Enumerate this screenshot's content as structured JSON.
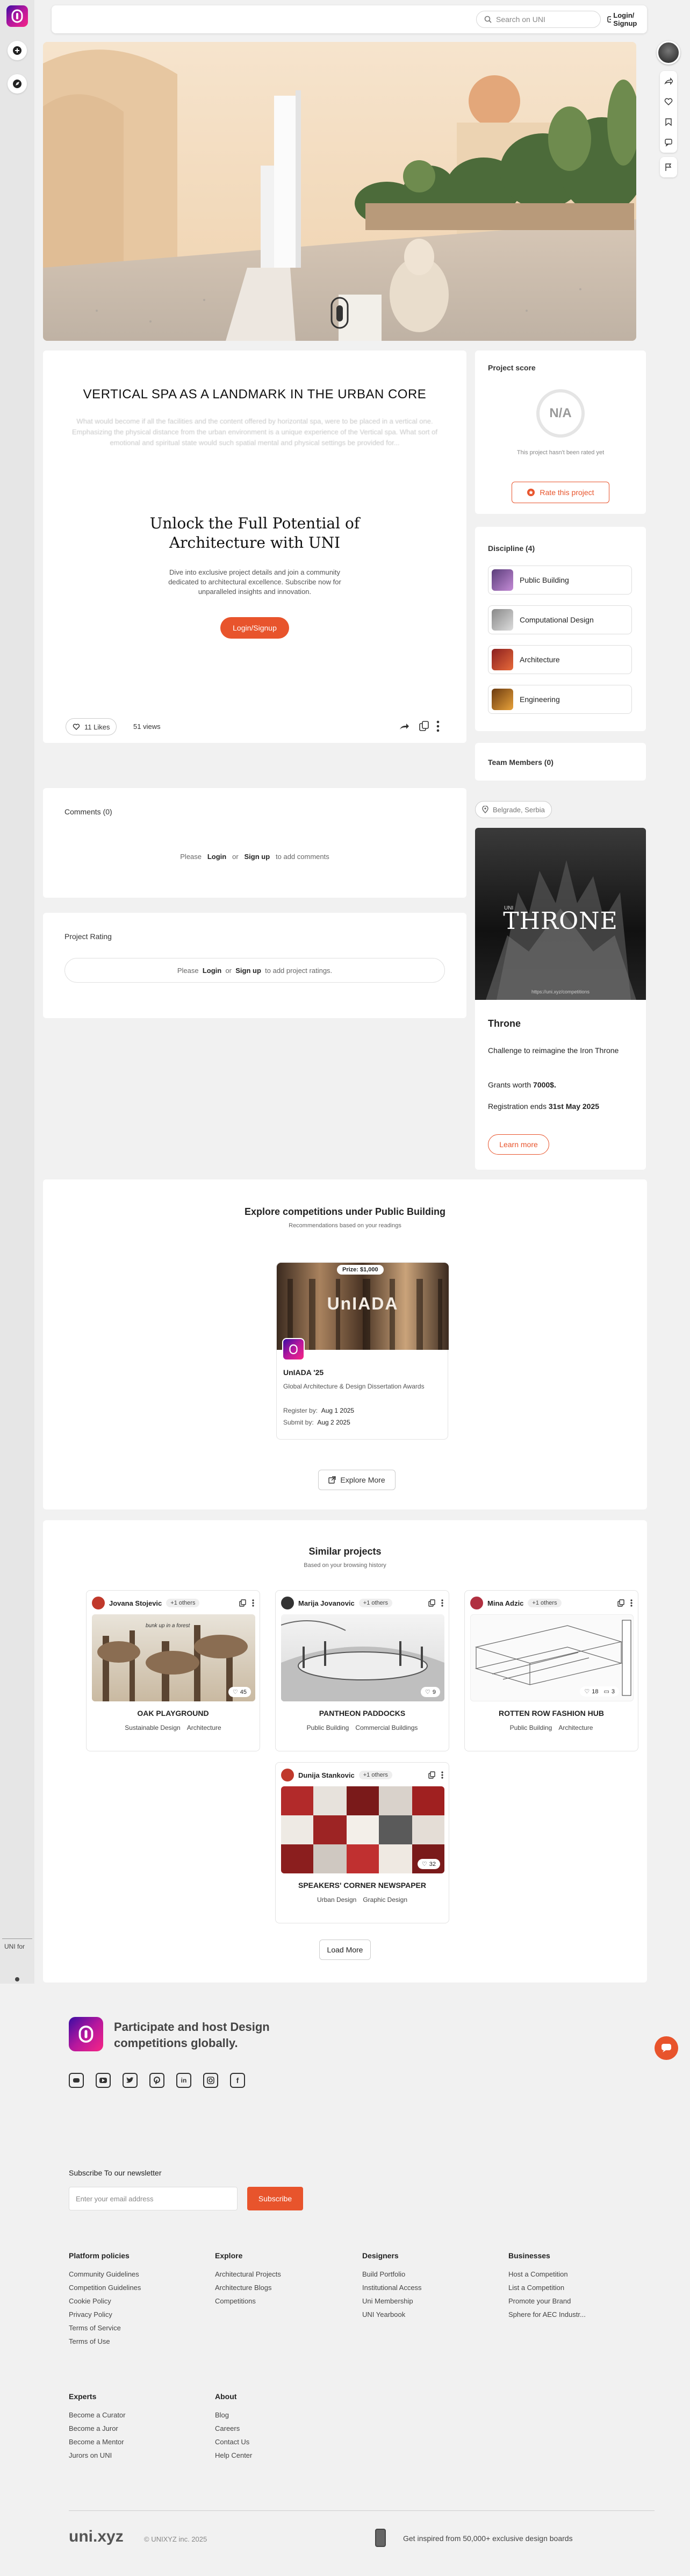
{
  "topbar": {
    "search_placeholder": "Search on UNI",
    "login_label": "Login/ Signup"
  },
  "sidebar": {
    "uni_for_label": "UNI for"
  },
  "project": {
    "title": "VERTICAL SPA AS A LANDMARK IN THE URBAN CORE",
    "description_preview": "What would become if all the facilities and the content offered by horizontal spa, were to be placed in a vertical one. Emphasizing the physical distance from the urban environment is a unique experience of the Vertical spa. What sort of emotional and spiritual state would such spatial mental and physical settings be provided for...",
    "unlock_title": "Unlock the Full Potential of Architecture with UNI",
    "unlock_text": "Dive into exclusive project details and join a community dedicated to architectural excellence. Subscribe now for unparalleled insights and innovation.",
    "unlock_button": "Login/Signup",
    "likes": "11 Likes",
    "views": "51 views"
  },
  "score": {
    "label": "Project score",
    "value": "N/A",
    "note": "This project hasn't been rated yet",
    "rate_button": "Rate this project"
  },
  "discipline": {
    "label": "Discipline (4)",
    "items": [
      {
        "label": "Public Building"
      },
      {
        "label": "Computational Design"
      },
      {
        "label": "Architecture"
      },
      {
        "label": "Engineering"
      }
    ]
  },
  "team": {
    "label": "Team Members (0)"
  },
  "location": {
    "label": "Belgrade, Serbia"
  },
  "comments": {
    "label": "Comments (0)",
    "please": "Please",
    "login": "Login",
    "or": "or",
    "signup": "Sign up",
    "suffix": "to add comments"
  },
  "rating": {
    "label": "Project Rating",
    "please": "Please",
    "login": "Login",
    "or": "or",
    "signup": "Sign up",
    "suffix": "to add project ratings."
  },
  "promo": {
    "image_title": "THRONE",
    "image_prefix": "UNI",
    "image_url": "https://uni.xyz/competitions",
    "title": "Throne",
    "desc": "Challenge to reimagine the Iron Throne",
    "grants_prefix": "Grants worth ",
    "grants_value": "7000$.",
    "reg_prefix": "Registration ends ",
    "reg_value": "31st May 2025",
    "button": "Learn more"
  },
  "explore": {
    "title": "Explore competitions under Public Building",
    "subtitle": "Recommendations based on your readings",
    "comp": {
      "prize": "Prize: $1,000",
      "image_text": "UnIADA",
      "name": "UnIADA '25",
      "desc": "Global Architecture & Design Dissertation Awards",
      "register_label": "Register by:",
      "register_date": "Aug 1 2025",
      "submit_label": "Submit by:",
      "submit_date": "Aug 2 2025"
    },
    "button": "Explore More"
  },
  "similar": {
    "title": "Similar projects",
    "subtitle": "Based on your browsing history",
    "projects": [
      {
        "author": "Jovana Stojevic",
        "others": "+1 others",
        "name": "OAK PLAYGROUND",
        "tags": [
          "Sustainable Design",
          "Architecture"
        ],
        "likes": "45",
        "img_caption": "bunk up in a forest"
      },
      {
        "author": "Marija Jovanovic",
        "others": "+1 others",
        "name": "PANTHEON PADDOCKS",
        "tags": [
          "Public Building",
          "Commercial Buildings"
        ],
        "likes": "9"
      },
      {
        "author": "Mina Adzic",
        "others": "+1 others",
        "name": "ROTTEN ROW FASHION HUB",
        "tags": [
          "Public Building",
          "Architecture"
        ],
        "likes": "18",
        "comments": "3"
      },
      {
        "author": "Dunija Stankovic",
        "others": "+1 others",
        "name": "SPEAKERS' CORNER NEWSPAPER",
        "tags": [
          "Urban Design",
          "Graphic Design"
        ],
        "likes": "32"
      }
    ],
    "load_more": "Load More"
  },
  "footer": {
    "tagline": "Participate and host Design competitions globally.",
    "newsletter_label": "Subscribe To our newsletter",
    "email_placeholder": "Enter your email address",
    "subscribe": "Subscribe",
    "columns": [
      {
        "title": "Platform policies",
        "links": [
          "Community Guidelines",
          "Competition Guidelines",
          "Cookie Policy",
          "Privacy Policy",
          "Terms of Service",
          "Terms of Use"
        ]
      },
      {
        "title": "Explore",
        "links": [
          "Architectural Projects",
          "Architecture Blogs",
          "Competitions"
        ]
      },
      {
        "title": "Designers",
        "links": [
          "Build Portfolio",
          "Institutional Access",
          "Uni Membership",
          "UNI Yearbook"
        ]
      },
      {
        "title": "Businesses",
        "links": [
          "Host a Competition",
          "List a Competition",
          "Promote your Brand",
          "Sphere for AEC Industr..."
        ]
      },
      {
        "title": "Experts",
        "links": [
          "Become a Curator",
          "Become a Juror",
          "Become a Mentor",
          "Jurors on UNI"
        ]
      },
      {
        "title": "About",
        "links": [
          "Blog",
          "Careers",
          "Contact Us",
          "Help Center"
        ]
      }
    ],
    "brand": "uni.xyz",
    "copyright": "© UNIXYZ inc. 2025",
    "app_promo": "Get inspired from 50,000+ exclusive design boards"
  }
}
